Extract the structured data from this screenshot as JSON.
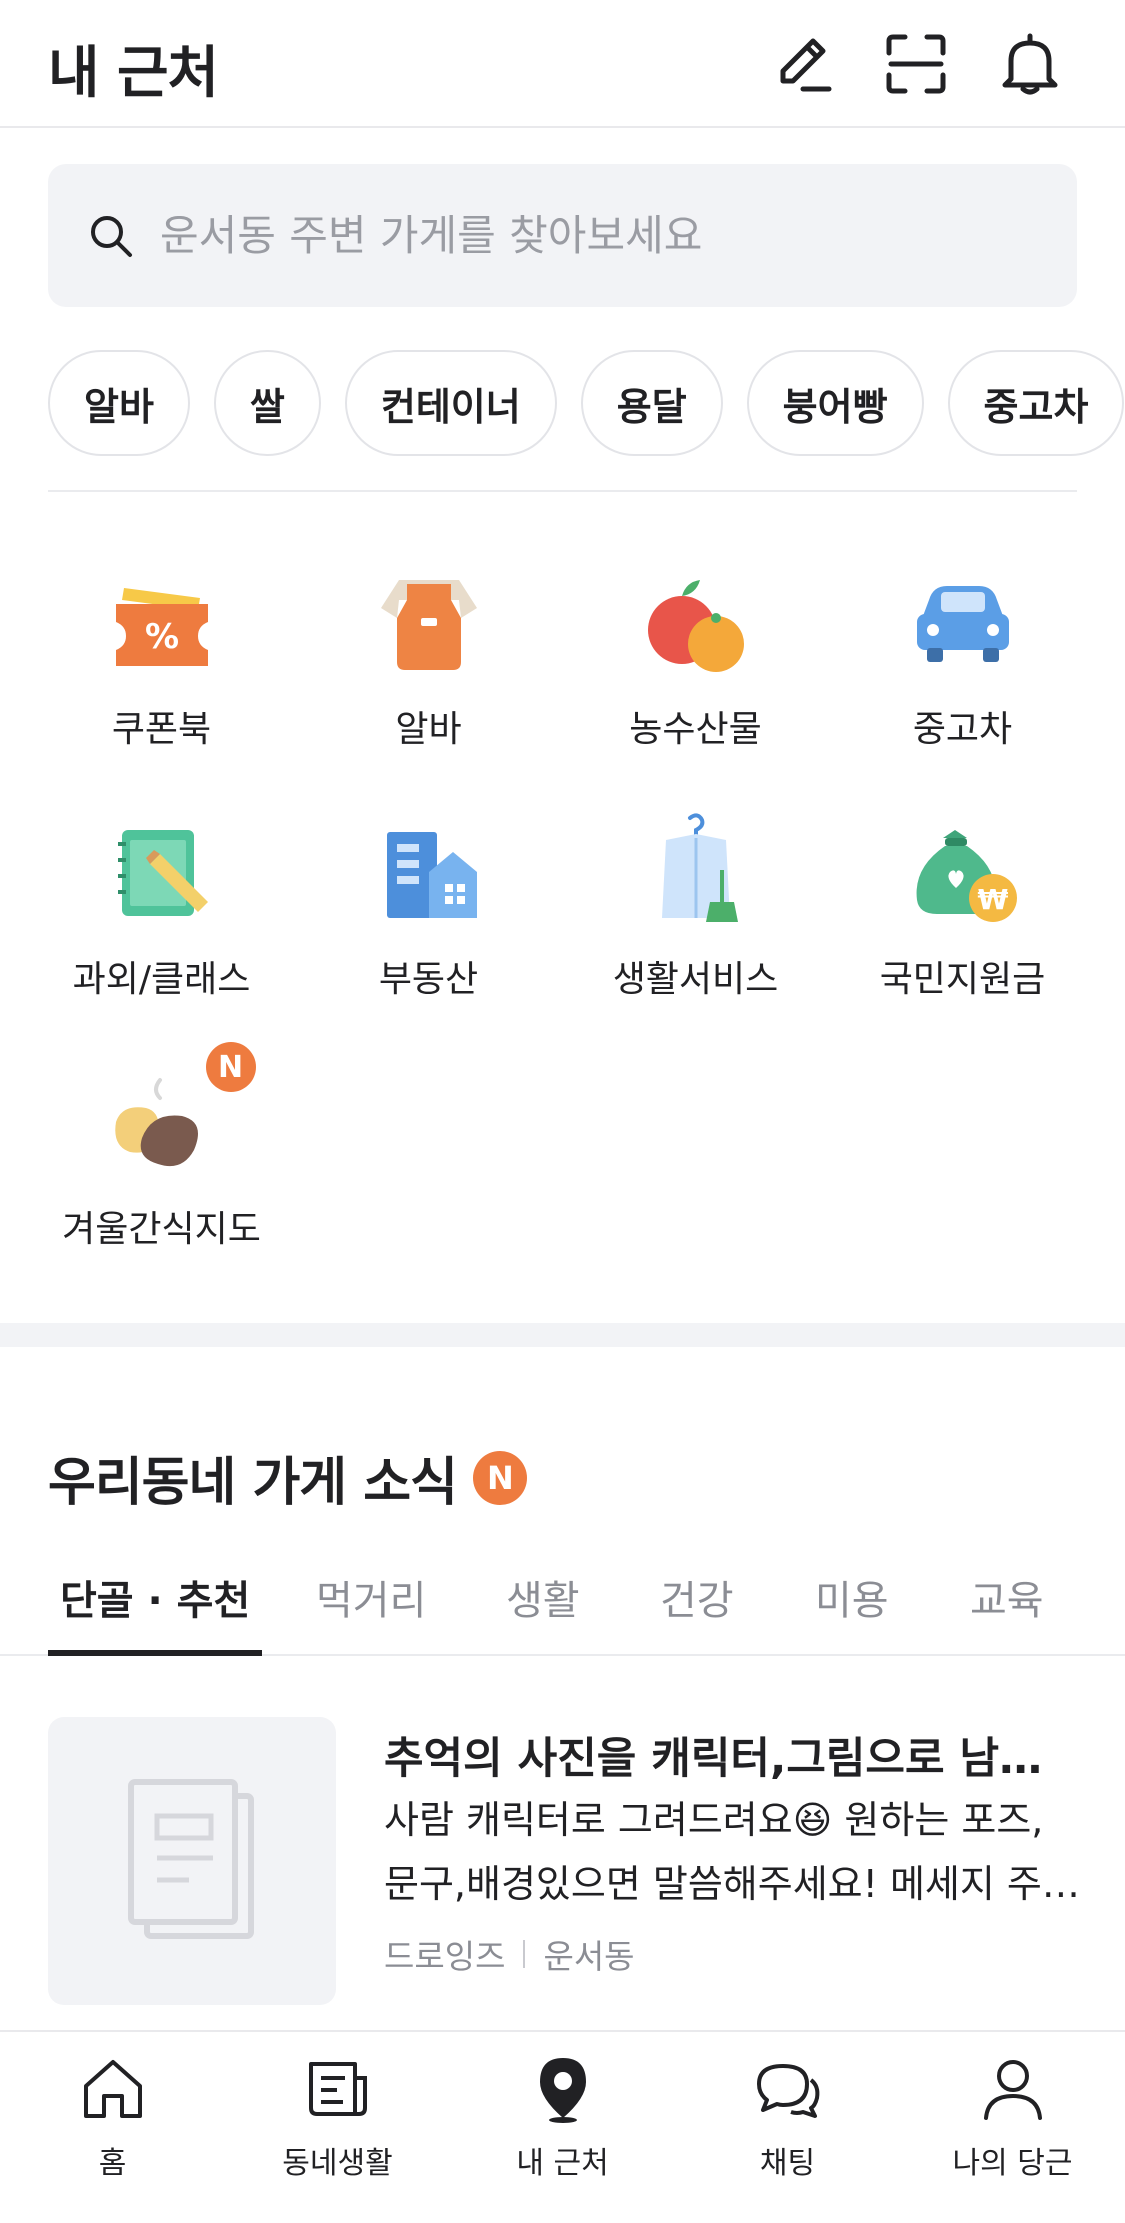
{
  "header": {
    "title": "내 근처",
    "icons": [
      "pencil-icon",
      "scan-icon",
      "bell-icon"
    ]
  },
  "search": {
    "placeholder": "운서동 주변 가게를 찾아보세요"
  },
  "chips": [
    "알바",
    "쌀",
    "컨테이너",
    "용달",
    "붕어빵",
    "중고차"
  ],
  "categories": [
    {
      "label": "쿠폰북",
      "icon": "coupon-icon"
    },
    {
      "label": "알바",
      "icon": "apron-icon"
    },
    {
      "label": "농수산물",
      "icon": "fruit-icon"
    },
    {
      "label": "중고차",
      "icon": "car-icon"
    },
    {
      "label": "과외/클래스",
      "icon": "notebook-icon"
    },
    {
      "label": "부동산",
      "icon": "building-icon"
    },
    {
      "label": "생활서비스",
      "icon": "laundry-icon"
    },
    {
      "label": "국민지원금",
      "icon": "money-bag-icon"
    },
    {
      "label": "겨울간식지도",
      "icon": "sweet-potato-icon",
      "badge": "N"
    }
  ],
  "news": {
    "title": "우리동네 가게 소식",
    "badge": "N",
    "tabs": [
      "단골 · 추천",
      "먹거리",
      "생활",
      "건강",
      "미용",
      "교육"
    ],
    "active_tab": "단골 · 추천",
    "article": {
      "title": "추억의 사진을 캐릭터,그림으로 남…",
      "desc_line1": "사람 캐릭터로 그려드려요😆 원하는 포즈,",
      "desc_line2": "문구,배경있으면 말씀해주세요! 메세지 주…",
      "store": "드로잉즈",
      "location": "운서동"
    }
  },
  "bottom_nav": [
    {
      "label": "홈",
      "icon": "home-icon"
    },
    {
      "label": "동네생활",
      "icon": "newspaper-icon"
    },
    {
      "label": "내 근처",
      "icon": "location-pin-icon",
      "active": true
    },
    {
      "label": "채팅",
      "icon": "chat-icon"
    },
    {
      "label": "나의 당근",
      "icon": "profile-icon"
    }
  ],
  "colors": {
    "accent": "#ee7b3f",
    "text": "#212124",
    "muted": "#8b8d94",
    "surface": "#f2f3f6"
  }
}
